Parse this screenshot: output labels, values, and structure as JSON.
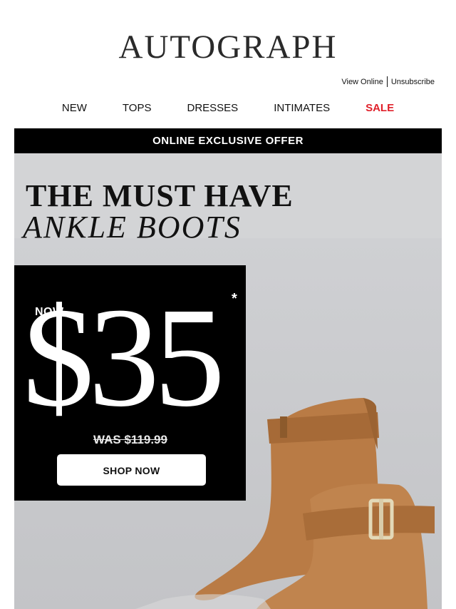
{
  "header": {
    "logo_text": "AUTOGRAPH",
    "utility_links": {
      "view_online": "View Online",
      "unsubscribe": "Unsubscribe"
    }
  },
  "nav": {
    "items": [
      {
        "label": "NEW"
      },
      {
        "label": "TOPS"
      },
      {
        "label": "DRESSES"
      },
      {
        "label": "INTIMATES"
      },
      {
        "label": "SALE"
      }
    ]
  },
  "hero": {
    "offer_bar": "ONLINE EXCLUSIVE OFFER",
    "headline_line1": "THE MUST HAVE",
    "headline_line2": "ANKLE BOOTS",
    "price_prefix": "NOW",
    "price": "$35",
    "price_footnote": "*",
    "was_price": "WAS $119.99",
    "cta_label": "SHOP NOW",
    "image": "tan-leather-ankle-boots"
  },
  "colors": {
    "sale": "#e0202a",
    "offer_bar_bg": "#000000",
    "hero_bg": "#d1d2d5",
    "boot_tan": "#b87a47"
  }
}
